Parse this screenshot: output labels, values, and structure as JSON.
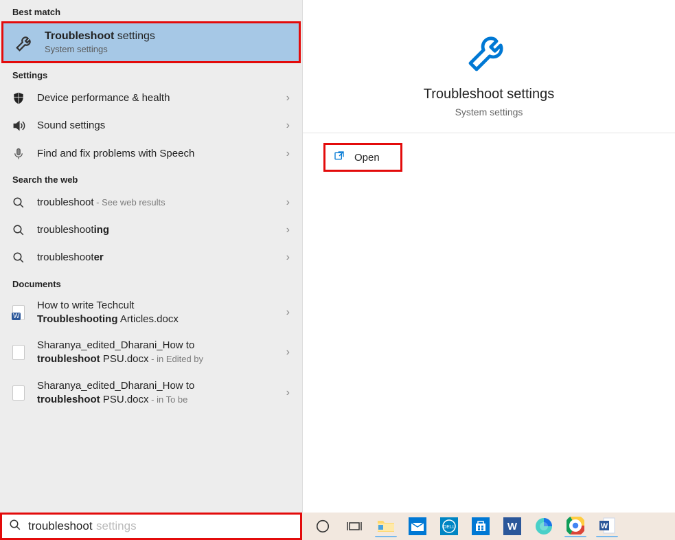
{
  "sections": {
    "best_match": "Best match",
    "settings": "Settings",
    "search_web": "Search the web",
    "documents": "Documents"
  },
  "best_match_item": {
    "title_prefix": "Troubleshoot",
    "title_suffix": " settings",
    "subtitle": "System settings"
  },
  "settings_items": [
    {
      "label": "Device performance & health",
      "icon": "shield-icon"
    },
    {
      "label": "Sound settings",
      "icon": "speaker-icon"
    },
    {
      "label": "Find and fix problems with Speech",
      "icon": "microphone-icon"
    }
  ],
  "web_items": [
    {
      "prefix": "troubleshoot",
      "suffix": " - See web results",
      "bold_suffix": ""
    },
    {
      "prefix": "troubleshoot",
      "suffix": "",
      "bold_suffix": "ing"
    },
    {
      "prefix": "troubleshoot",
      "suffix": "",
      "bold_suffix": "er"
    }
  ],
  "doc_items": [
    {
      "line1_pre": "How to write Techcult ",
      "line1_bold": "",
      "line2_bold": "Troubleshooting",
      "line2_post": " Articles.docx",
      "icon": "word-doc-icon"
    },
    {
      "line1_pre": "Sharanya_edited_Dharani_How to ",
      "line2_bold": "troubleshoot",
      "line2_post": " PSU.docx",
      "loc": " - in Edited by",
      "icon": "text-doc-icon"
    },
    {
      "line1_pre": "Sharanya_edited_Dharani_How to ",
      "line2_bold": "troubleshoot",
      "line2_post": " PSU.docx",
      "loc": " - in To be",
      "icon": "text-doc-icon"
    }
  ],
  "detail": {
    "title": "Troubleshoot settings",
    "subtitle": "System settings",
    "open_label": "Open"
  },
  "search": {
    "value": "troubleshoot",
    "ghost": " settings"
  },
  "taskbar": [
    {
      "name": "cortana-icon",
      "color": "#333"
    },
    {
      "name": "task-view-icon",
      "color": "#333"
    },
    {
      "name": "file-explorer-icon"
    },
    {
      "name": "mail-icon"
    },
    {
      "name": "dell-app-icon"
    },
    {
      "name": "store-tile-icon"
    },
    {
      "name": "word-tile-icon"
    },
    {
      "name": "edge-icon"
    },
    {
      "name": "chrome-icon"
    },
    {
      "name": "word-app-icon"
    }
  ]
}
